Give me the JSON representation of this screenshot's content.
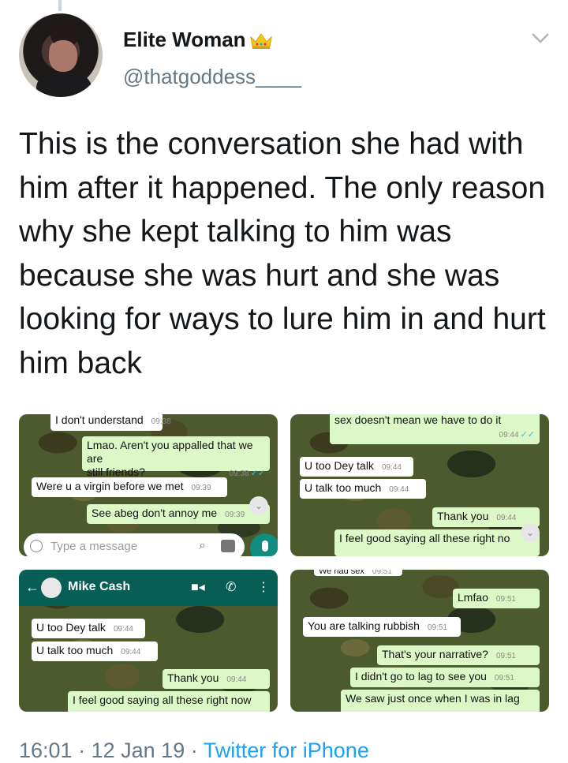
{
  "tweet": {
    "display_name": "Elite Woman",
    "handle": "@thatgoddess____",
    "text": "This is the conversation she had with him after it happened. The only reason why she kept talking to him was because she was hurt and she was looking for ways to lure him in and hurt him back",
    "time": "16:01",
    "date": "12 Jan 19",
    "separator": "·",
    "source": "Twitter for iPhone"
  },
  "icons": [
    "crown-icon",
    "chevron-down-icon",
    "smiley-icon",
    "attach-icon",
    "camera-icon",
    "mic-icon",
    "back-arrow-icon",
    "video-icon",
    "call-icon",
    "more-icon",
    "scroll-down-icon"
  ],
  "panel1": {
    "messages": [
      {
        "text": "I don't understand",
        "time": "09:38"
      },
      {
        "text": "Lmao. Aren't you appalled that we are",
        "text2": "still friends?",
        "time": "09:38"
      },
      {
        "text": "Were u a virgin before we met",
        "time": "09:39"
      },
      {
        "text": "See abeg don't annoy me",
        "time": "09:39"
      }
    ],
    "input_placeholder": "Type a message"
  },
  "panel2": {
    "messages": [
      {
        "text": "sex doesn't mean we have to do it",
        "time": "09:44"
      },
      {
        "text": "U too Dey talk",
        "time": "09:44"
      },
      {
        "text": "U talk too much",
        "time": "09:44"
      },
      {
        "text": "Thank you",
        "time": "09:44"
      },
      {
        "text": "I feel good saying all these right no"
      }
    ]
  },
  "panel3": {
    "contact_name": "Mike Cash",
    "messages": [
      {
        "text": "U too Dey talk",
        "time": "09:44"
      },
      {
        "text": "U talk too much",
        "time": "09:44"
      },
      {
        "text": "Thank you",
        "time": "09:44"
      },
      {
        "text": "I feel good saying all these right now"
      }
    ]
  },
  "panel4": {
    "messages": [
      {
        "text": "We had sex",
        "time": "09:51"
      },
      {
        "text": "Lmfao",
        "time": "09:51"
      },
      {
        "text": "You are talking rubbish",
        "time": "09:51"
      },
      {
        "text": "That's your narrative?",
        "time": "09:51"
      },
      {
        "text": "I didn't go to lag to see you",
        "time": "09:51"
      },
      {
        "text": "We saw just once when I was in lag"
      }
    ]
  },
  "ticks": "✓✓",
  "colors": {
    "blue": "#1da1f2",
    "gray": "#657786",
    "wa_green": "#075e54",
    "bubble_out": "#dcf8c6"
  }
}
